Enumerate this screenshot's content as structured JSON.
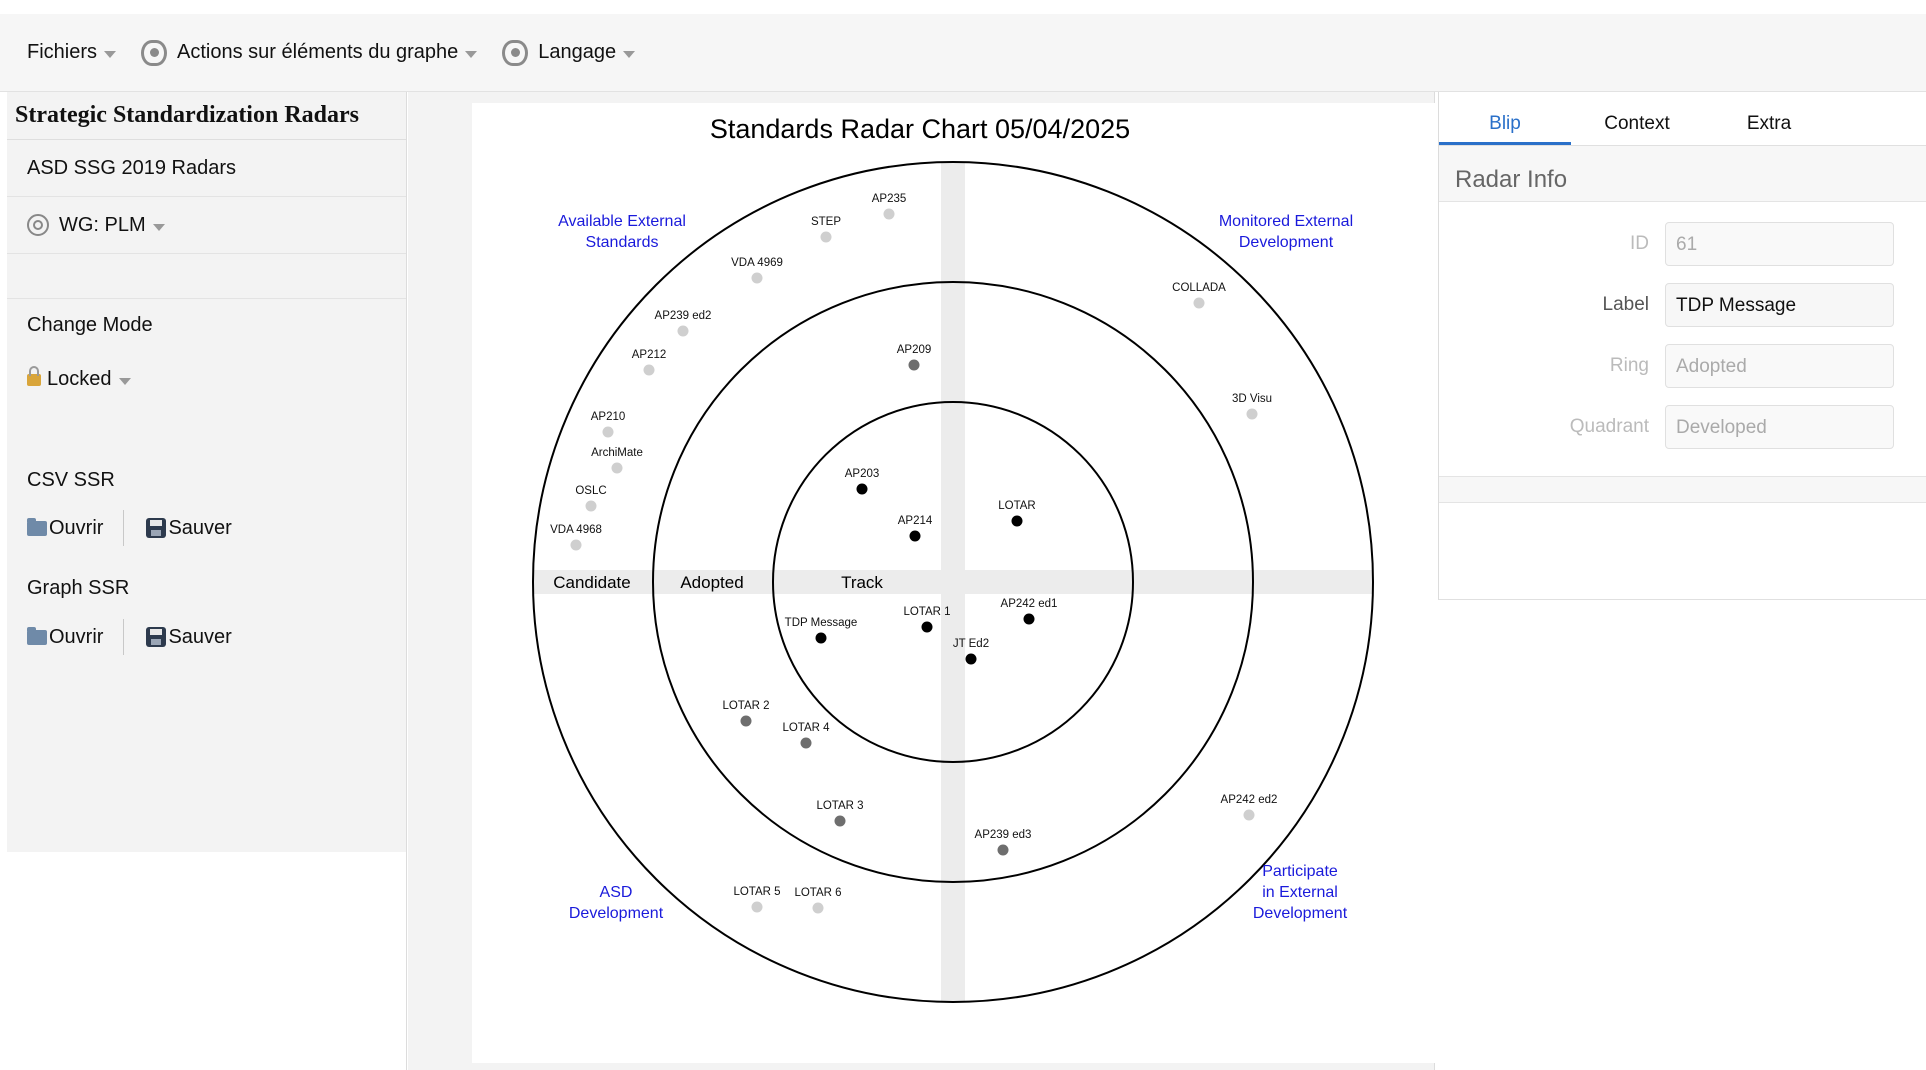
{
  "menubar": {
    "files": "Fichiers",
    "graph_actions": "Actions sur éléments du graphe",
    "language": "Langage"
  },
  "sidebar": {
    "title": "Strategic Standardization Radars",
    "radar_set": "ASD SSG 2019 Radars",
    "wg": "WG: PLM",
    "change_mode": "Change Mode",
    "lock_state": "Locked",
    "csv_section": "CSV SSR",
    "graph_section": "Graph SSR",
    "open_label": "Ouvrir",
    "save_label": "Sauver"
  },
  "chart": {
    "title": "Standards Radar Chart 05/04/2025",
    "quadrants": [
      [
        "Available External",
        "Standards"
      ],
      [
        "Monitored External",
        "Development"
      ],
      [
        "ASD",
        "Development"
      ],
      [
        "Participate",
        "in External",
        "Development"
      ]
    ],
    "rings": [
      "Candidate",
      "Adopted",
      "Track"
    ],
    "colors": {
      "ring_track": "#000000",
      "ring_adopted": "#6e6e6e",
      "ring_candidate": "#cfcfcf",
      "quadrant_label": "#1a1adb",
      "axis_band": "#ececec"
    },
    "blips": [
      {
        "label": "AP235",
        "ring": "Candidate"
      },
      {
        "label": "STEP",
        "ring": "Candidate"
      },
      {
        "label": "VDA 4969",
        "ring": "Candidate"
      },
      {
        "label": "AP239 ed2",
        "ring": "Candidate"
      },
      {
        "label": "AP212",
        "ring": "Candidate"
      },
      {
        "label": "AP210",
        "ring": "Candidate"
      },
      {
        "label": "ArchiMate",
        "ring": "Candidate"
      },
      {
        "label": "OSLC",
        "ring": "Candidate"
      },
      {
        "label": "VDA 4968",
        "ring": "Candidate"
      },
      {
        "label": "AP209",
        "ring": "Adopted"
      },
      {
        "label": "COLLADA",
        "ring": "Candidate"
      },
      {
        "label": "3D Visu",
        "ring": "Candidate"
      },
      {
        "label": "AP203",
        "ring": "Track"
      },
      {
        "label": "AP214",
        "ring": "Track"
      },
      {
        "label": "LOTAR",
        "ring": "Track"
      },
      {
        "label": "TDP Message",
        "ring": "Track"
      },
      {
        "label": "LOTAR 1",
        "ring": "Track"
      },
      {
        "label": "AP242 ed1",
        "ring": "Track"
      },
      {
        "label": "JT Ed2",
        "ring": "Track"
      },
      {
        "label": "LOTAR 2",
        "ring": "Adopted"
      },
      {
        "label": "LOTAR 4",
        "ring": "Adopted"
      },
      {
        "label": "LOTAR 3",
        "ring": "Adopted"
      },
      {
        "label": "AP239 ed3",
        "ring": "Adopted"
      },
      {
        "label": "AP242 ed2",
        "ring": "Candidate"
      },
      {
        "label": "LOTAR 5",
        "ring": "Candidate"
      },
      {
        "label": "LOTAR 6",
        "ring": "Candidate"
      }
    ]
  },
  "details": {
    "tabs": [
      "Blip",
      "Context",
      "Extra"
    ],
    "active_tab": "Blip",
    "section_title": "Radar Info",
    "fields": [
      {
        "label": "ID",
        "value": "61"
      },
      {
        "label": "Label",
        "value": "TDP Message"
      },
      {
        "label": "Ring",
        "value": "Adopted"
      },
      {
        "label": "Quadrant",
        "value": "Developed"
      }
    ]
  }
}
